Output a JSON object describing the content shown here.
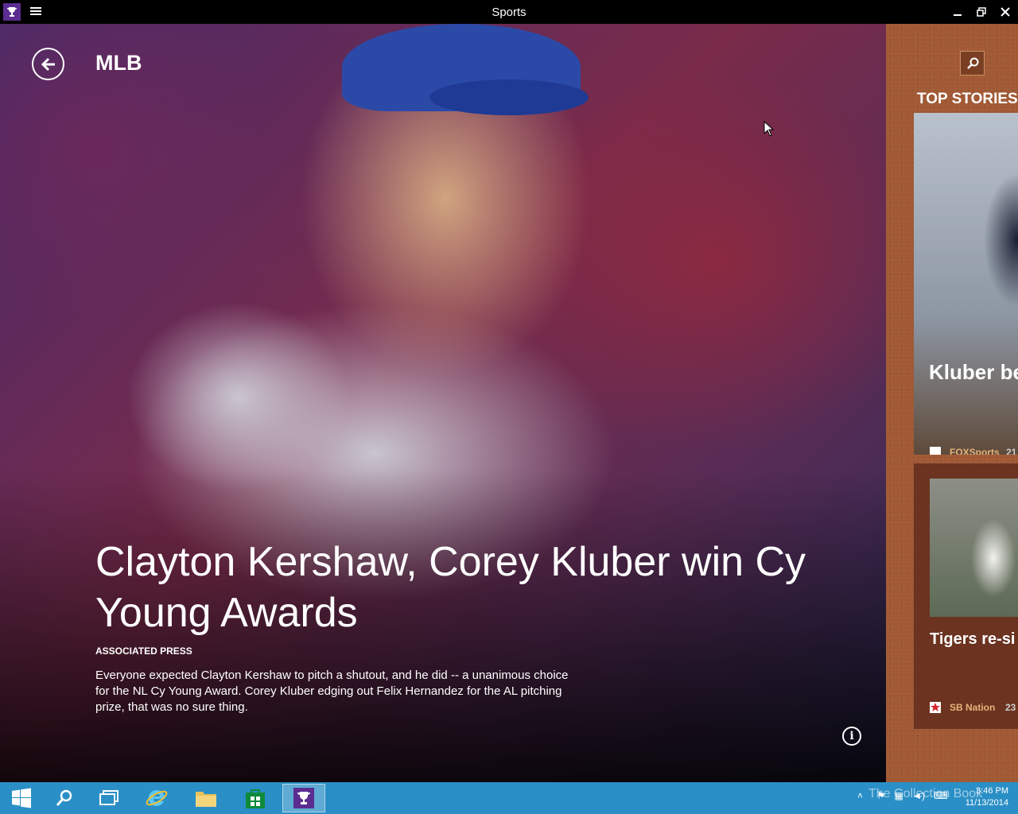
{
  "window": {
    "title": "Sports"
  },
  "header": {
    "section": "MLB"
  },
  "hero": {
    "headline": "Clayton Kershaw, Corey Kluber win Cy Young Awards",
    "source": "ASSOCIATED PRESS",
    "summary": "Everyone expected Clayton Kershaw to pitch a shutout, and he did -- a unanimous choice for the NL Cy Young Award. Corey Kluber edging out Felix Hernandez for the AL pitching prize, that was no sure thing."
  },
  "sidebar": {
    "heading": "TOP STORIES",
    "stories": [
      {
        "title": "Kluber be ballot —",
        "source": "FOXSports",
        "time": "21"
      },
      {
        "title": "Tigers re-si to four-yea contract",
        "source": "SB Nation",
        "time": "23"
      }
    ]
  },
  "taskbar": {
    "clock_time": "3:46 PM",
    "clock_date": "11/13/2014",
    "watermark": "The Collection Book"
  },
  "colors": {
    "accent": "#2a8fc6",
    "panel": "#a15a35",
    "app_icon": "#5b2d90"
  }
}
